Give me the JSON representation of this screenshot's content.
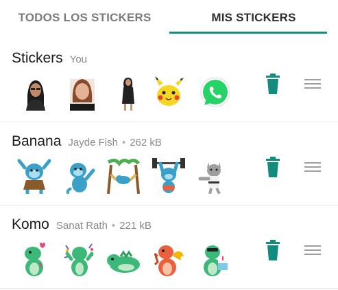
{
  "tabs": [
    {
      "label": "TODOS LOS STICKERS",
      "active": false
    },
    {
      "label": "MIS STICKERS",
      "active": true
    }
  ],
  "colors": {
    "accent": "#128c7e",
    "delete_icon": "#128c7e",
    "handle": "#9e9e9e"
  },
  "packs": [
    {
      "name": "Stickers",
      "author": "You",
      "size": "",
      "stickers": [
        "woman-glasses-photo-sticker",
        "woman-portrait-photo-sticker",
        "woman-standing-photo-sticker",
        "pikachu-sticker",
        "whatsapp-logo-sticker"
      ]
    },
    {
      "name": "Banana",
      "author": "Jayde Fish",
      "size": "262 kB",
      "stickers": [
        "monkey-hula-sticker",
        "monkey-waving-sticker",
        "monkey-hammock-sticker",
        "monkey-weights-sticker",
        "cat-karate-sticker"
      ]
    },
    {
      "name": "Komo",
      "author": "Sanat Rath",
      "size": "221 kB",
      "stickers": [
        "dino-hearts-sticker",
        "dino-party-sticker",
        "dino-lying-sticker",
        "dino-fire-sticker",
        "dino-cake-sticker"
      ]
    }
  ]
}
